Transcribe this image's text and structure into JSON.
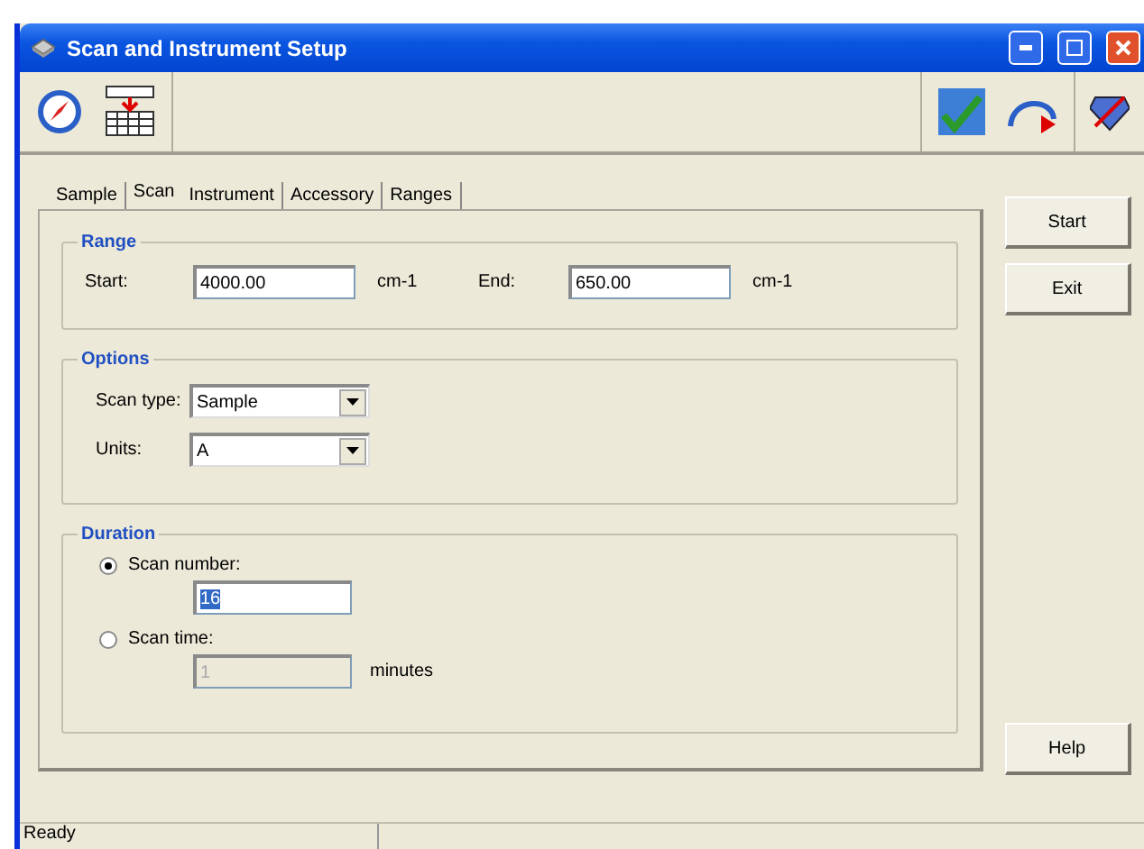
{
  "window": {
    "title": "Scan and Instrument Setup"
  },
  "tabs": [
    {
      "label": "Sample",
      "selected": false
    },
    {
      "label": "Scan",
      "selected": true
    },
    {
      "label": "Instrument",
      "selected": false
    },
    {
      "label": "Accessory",
      "selected": false
    },
    {
      "label": "Ranges",
      "selected": false
    }
  ],
  "range": {
    "title": "Range",
    "fields": [
      {
        "label": "Start:",
        "value": "4000.00",
        "unit": "cm-1"
      },
      {
        "label": "End:",
        "value": "650.00",
        "unit": "cm-1"
      }
    ]
  },
  "options": {
    "title": "Options",
    "fields": [
      {
        "label": "Scan type:",
        "value": "Sample"
      },
      {
        "label": "Units:",
        "value": "A"
      }
    ]
  },
  "duration": {
    "title": "Duration",
    "choices": [
      {
        "label": "Scan number:",
        "selected": true,
        "value": "16",
        "highlighted": true,
        "disabled": false
      },
      {
        "label": "Scan time:",
        "selected": false,
        "value": "1",
        "unit": "minutes",
        "highlighted": false,
        "disabled": true
      }
    ]
  },
  "buttons": [
    {
      "label": "Start"
    },
    {
      "label": "Exit"
    }
  ],
  "help_button": {
    "label": "Help"
  },
  "status_bar": {
    "text": "Ready"
  }
}
